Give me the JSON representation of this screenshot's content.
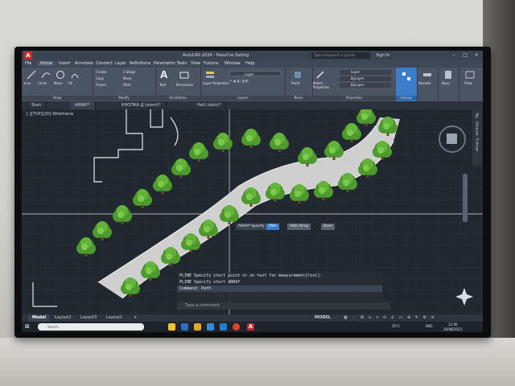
{
  "app": {
    "logo": "A",
    "title": "AutoCAD 2024 - Pass/Cas Sisting",
    "search_placeholder": "Type a keyword or phrase",
    "sign_in": "Sign In"
  },
  "menu": [
    "File",
    "Home",
    "Insert",
    "Annotate",
    "Connect",
    "Layer",
    "Refinitions",
    "Parametric Tools",
    "View",
    "Fusions",
    "Window",
    "Help"
  ],
  "ribbon": {
    "tools": {
      "line": "Line",
      "circle": "Circle",
      "move": "Move",
      "file": "Fill",
      "create": "Create",
      "stretch": "1 Stage",
      "copy": "Copy",
      "move2": "Move",
      "frozen": "Frozen",
      "fillet": "Fillet",
      "text": "Text",
      "dimension": "Dimension",
      "layer_properties": "Layer Properties",
      "layer_value": "Layer",
      "paste": "Paste",
      "match": "Match Properties",
      "layer_combo": "Layer",
      "bylayer1": "ByLayer",
      "bylayer2": "ByLayer",
      "select": "Remote",
      "base": "Base",
      "view": "View"
    },
    "groups": [
      "Draw",
      "Modify",
      "Annotation",
      "Layers",
      "Block",
      "Properties",
      "Groups"
    ]
  },
  "doc_tabs": [
    "Start",
    "ARRAY*",
    "КНОПКА Д (etent)*",
    "Path (dsts)*"
  ],
  "viewport": {
    "label": "[-][TOP][2D] Wireframe",
    "nav": [
      "Top",
      "Unsaved",
      "Fullview"
    ]
  },
  "array_tooltip": {
    "prompt": "ARRAY Specify",
    "option1": "Path",
    "option2": "Path Array",
    "option3": "Base"
  },
  "command": {
    "lines": [
      "PLINE Specify start point or on test for measurement[tool]:",
      "PLINE Specify start ARRAY",
      "Command: Path"
    ],
    "placeholder": "Type a command"
  },
  "layout_tabs": [
    "Model",
    "Layout2",
    "Layout3",
    "Layout1"
  ],
  "status": {
    "model": "MODEL"
  },
  "taskbar": {
    "search": "Search",
    "weather": "35°C",
    "lang": "ENG",
    "time": "12:00",
    "date": "20/08/2023"
  },
  "colors": {
    "autocad_red": "#c8282e",
    "tree_green": "#4f9a2f",
    "path_gray": "#cfcfcf",
    "accent_blue": "#3d7cc9"
  }
}
